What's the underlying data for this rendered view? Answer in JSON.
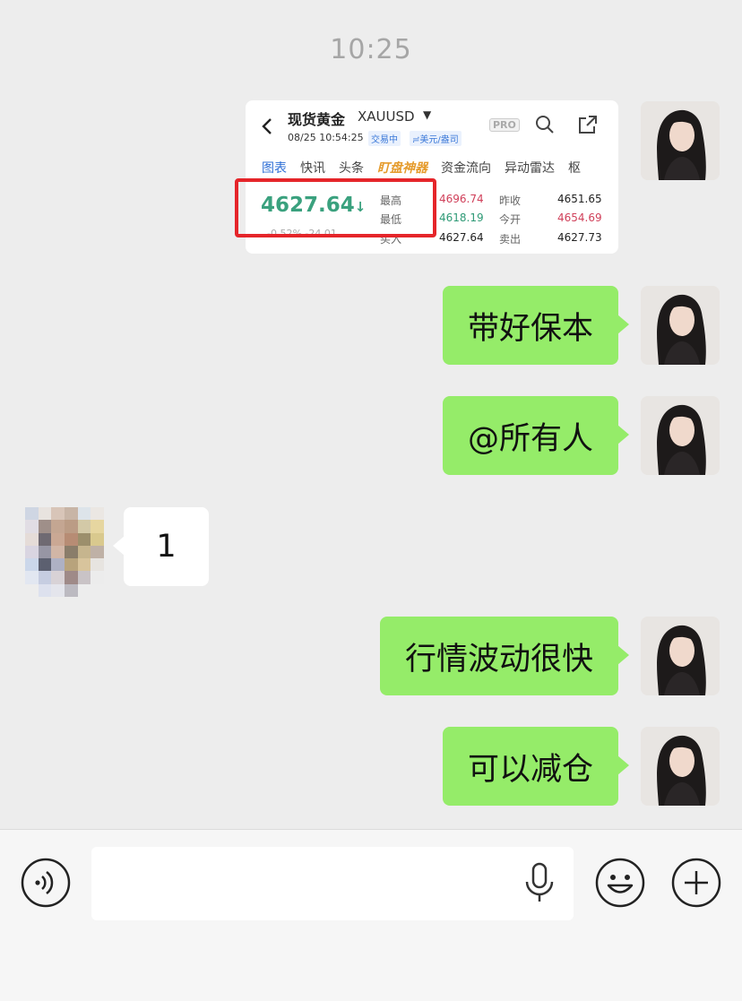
{
  "status": {
    "time": "10:25"
  },
  "shared_card": {
    "title": "现货黄金",
    "symbol": "XAUUSD",
    "datetime": "08/25 10:54:25",
    "tag_trading": "交易中",
    "tag_currency": "≓美元/盎司",
    "pro_label": "PRO",
    "tabs": [
      "图表",
      "快讯",
      "头条",
      "盯盘神器",
      "资金流向",
      "异动雷达",
      "枢"
    ],
    "price": "4627.64",
    "price_arrow": "↓",
    "change_faded": "-0.52%   -24.01",
    "labels": {
      "high": "最高",
      "low": "最低",
      "buy": "买入",
      "prev_close": "昨收",
      "open": "今开",
      "sell": "卖出"
    },
    "values": {
      "high": "4696.74",
      "low": "4618.19",
      "buy": "4627.64",
      "prev_close": "4651.65",
      "open": "4654.69",
      "sell": "4627.73"
    }
  },
  "messages": [
    {
      "side": "me",
      "text": "带好保本"
    },
    {
      "side": "me",
      "text": "@所有人"
    },
    {
      "side": "other",
      "text": "1"
    },
    {
      "side": "me",
      "text": "行情波动很快"
    },
    {
      "side": "me",
      "text": "可以减仓"
    }
  ],
  "colors": {
    "background": "#ededed",
    "my_bubble": "#95ec69",
    "other_bubble": "#ffffff",
    "highlight_box": "#e5252a"
  },
  "icons": {
    "voice": "voice-toggle-icon",
    "mic": "microphone-icon",
    "emoji": "emoji-icon",
    "more": "plus-icon"
  }
}
